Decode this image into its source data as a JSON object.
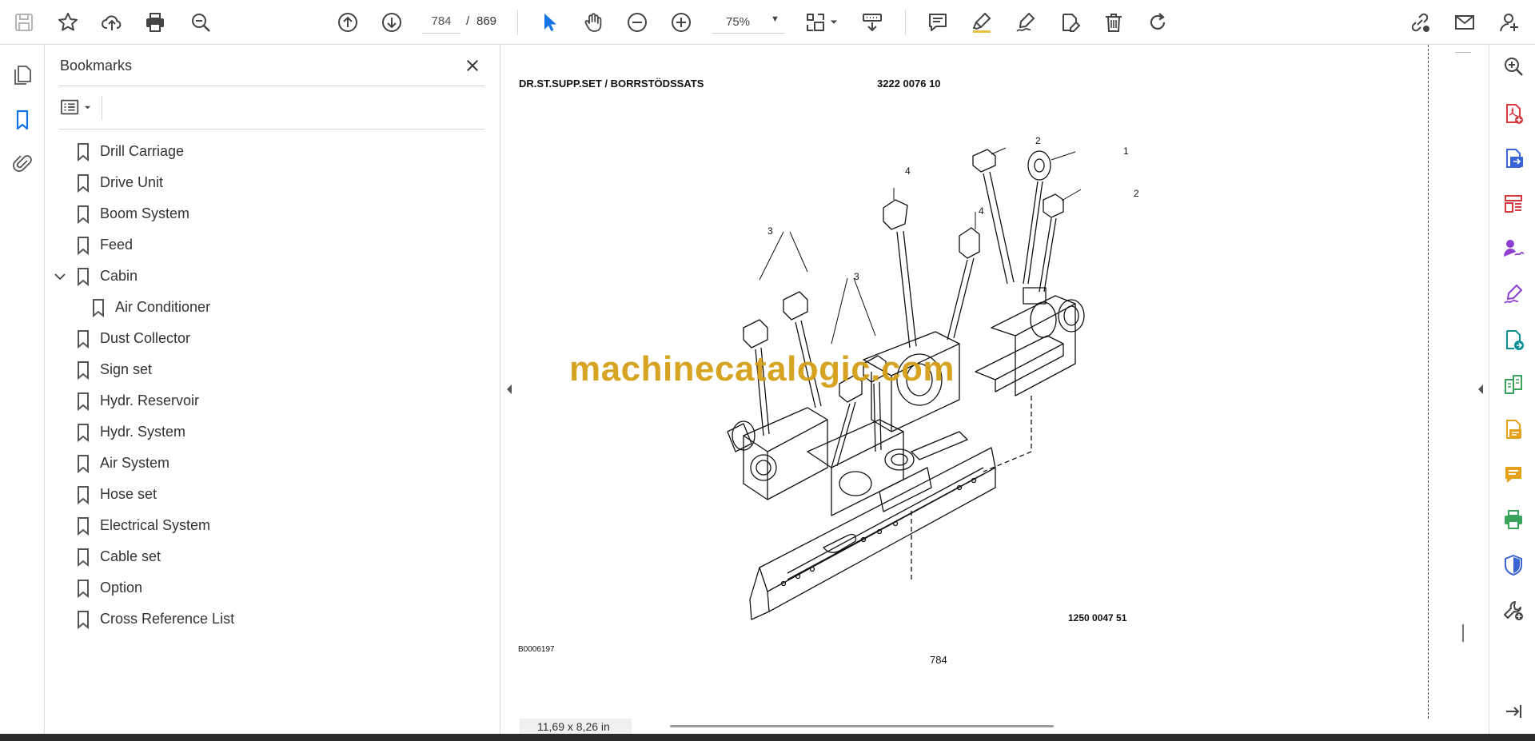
{
  "toolbar": {
    "current_page": "784",
    "page_separator": "/",
    "total_pages": "869",
    "zoom": "75%",
    "icons": [
      "save-icon",
      "star-icon",
      "upload-icon",
      "print-icon",
      "find-icon",
      "prev-page-icon",
      "next-page-icon",
      "select-arrow-icon",
      "hand-icon",
      "zoom-out-icon",
      "zoom-in-icon",
      "page-fit-icon",
      "scroll-mode-icon",
      "comment-icon",
      "highlight-icon",
      "sign-icon",
      "fill-sign-icon",
      "delete-icon",
      "rotate-icon",
      "share-link-icon",
      "email-icon",
      "account-icon"
    ]
  },
  "left_rail": {
    "icons": [
      "page-thumbnails-icon",
      "bookmarks-icon",
      "attachments-icon"
    ]
  },
  "bookmarks": {
    "title": "Bookmarks",
    "items": [
      {
        "label": "Drill Carriage",
        "level": 0,
        "expanded": false
      },
      {
        "label": "Drive Unit",
        "level": 0,
        "expanded": false
      },
      {
        "label": "Boom System",
        "level": 0,
        "expanded": false
      },
      {
        "label": "Feed",
        "level": 0,
        "expanded": false
      },
      {
        "label": "Cabin",
        "level": 0,
        "expanded": true
      },
      {
        "label": "Air Conditioner",
        "level": 1,
        "expanded": false
      },
      {
        "label": "Dust Collector",
        "level": 0,
        "expanded": false
      },
      {
        "label": "Sign set",
        "level": 0,
        "expanded": false
      },
      {
        "label": "Hydr. Reservoir",
        "level": 0,
        "expanded": false
      },
      {
        "label": "Hydr. System",
        "level": 0,
        "expanded": false
      },
      {
        "label": "Air System",
        "level": 0,
        "expanded": false
      },
      {
        "label": "Hose set",
        "level": 0,
        "expanded": false
      },
      {
        "label": "Electrical System",
        "level": 0,
        "expanded": false
      },
      {
        "label": "Cable set",
        "level": 0,
        "expanded": false
      },
      {
        "label": "Option",
        "level": 0,
        "expanded": false
      },
      {
        "label": "Cross Reference List",
        "level": 0,
        "expanded": false
      }
    ]
  },
  "document": {
    "header": "DR.ST.SUPP.SET / BORRSTÖDSSATS",
    "part_number": "3222 0076 10",
    "drawing_number": "1250 0047 51",
    "figure_id": "B0006197",
    "page_number": "784",
    "watermark": "machinecatalogic.com",
    "callouts": {
      "c1": "1",
      "c2": "2",
      "c3": "3",
      "c4": "4"
    },
    "page_size": "11,69 x 8,26 in"
  },
  "right_rail": {
    "icons": [
      "zoom-search-icon",
      "create-pdf-icon",
      "export-pdf-icon",
      "organize-pages-icon",
      "request-signatures-icon",
      "fill-and-sign-icon",
      "send-for-review-icon",
      "compare-files-icon",
      "edit-pdf-icon",
      "comment-tool-icon",
      "print-production-icon",
      "protect-icon",
      "more-tools-icon",
      "expand-panel-icon"
    ]
  },
  "colors": {
    "accent": "#1473e6",
    "watermark": "#d4a017",
    "red_tool": "#d7373f",
    "purple_tool": "#8c3fd1"
  }
}
